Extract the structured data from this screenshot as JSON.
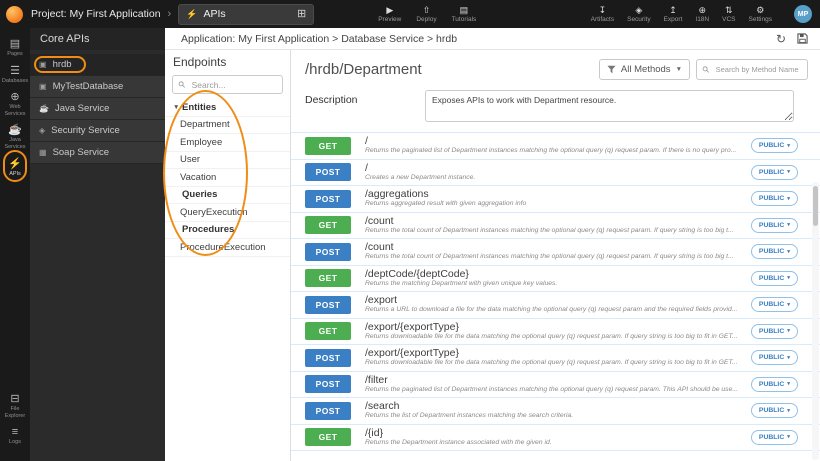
{
  "topbar": {
    "project": "Project: My First Application",
    "chevron": "›",
    "tab": {
      "label": "APIs",
      "icon_glyph": "⚡",
      "grid_glyph": "⊞"
    },
    "center_actions": [
      {
        "name": "preview",
        "label": "Preview",
        "glyph": "▶"
      },
      {
        "name": "deploy",
        "label": "Deploy",
        "glyph": "⇧"
      },
      {
        "name": "tutorials",
        "label": "Tutorials",
        "glyph": "▤"
      }
    ],
    "right_actions": [
      {
        "name": "artifacts",
        "label": "Artifacts",
        "glyph": "↧"
      },
      {
        "name": "security",
        "label": "Security",
        "glyph": "◈"
      },
      {
        "name": "export",
        "label": "Export",
        "glyph": "↥"
      },
      {
        "name": "i18n",
        "label": "I18N",
        "glyph": "⊕"
      },
      {
        "name": "vcs",
        "label": "VCS",
        "glyph": "⇅"
      },
      {
        "name": "settings",
        "label": "Settings",
        "glyph": "⚙"
      }
    ],
    "avatar_initials": "MP"
  },
  "rail": {
    "top_items": [
      {
        "name": "pages",
        "label": "Pages",
        "glyph": "▤"
      },
      {
        "name": "databases",
        "label": "Databases",
        "glyph": "☰"
      },
      {
        "name": "web-services",
        "label": "Web Services",
        "glyph": "⊕"
      },
      {
        "name": "java-services",
        "label": "Java Services",
        "glyph": "☕"
      },
      {
        "name": "apis",
        "label": "APIs",
        "glyph": "⚡",
        "cls": "active"
      }
    ],
    "bottom_items": [
      {
        "name": "file-explorer",
        "label": "File Explorer",
        "glyph": "⊟"
      },
      {
        "name": "logs",
        "label": "Logs",
        "glyph": "≡"
      }
    ]
  },
  "sidebar": {
    "title": "Core APIs",
    "items": [
      {
        "name": "hrdb",
        "label": "hrdb",
        "glyph": "▣",
        "cls": "selected"
      },
      {
        "name": "mytestdatabase",
        "label": "MyTestDatabase",
        "glyph": "▣"
      },
      {
        "name": "java-service",
        "label": "Java Service",
        "glyph": "☕"
      },
      {
        "name": "security-service",
        "label": "Security Service",
        "glyph": "◈"
      },
      {
        "name": "soap-service",
        "label": "Soap Service",
        "glyph": "▦"
      }
    ]
  },
  "breadcrumb": {
    "text": "Application: My First Application > Database Service > hrdb",
    "refresh_glyph": "↻"
  },
  "endpoints": {
    "title": "Endpoints",
    "search_placeholder": "Search...",
    "tree": [
      {
        "label": "Entities",
        "cls": "group",
        "caret": "▼"
      },
      {
        "label": "Department",
        "cls": "leaf"
      },
      {
        "label": "Employee",
        "cls": "leaf"
      },
      {
        "label": "User",
        "cls": "leaf"
      },
      {
        "label": "Vacation",
        "cls": "leaf"
      },
      {
        "label": "Queries",
        "cls": "group"
      },
      {
        "label": "QueryExecution",
        "cls": "leaf"
      },
      {
        "label": "Procedures",
        "cls": "group"
      },
      {
        "label": "ProcedureExecution",
        "cls": "leaf"
      }
    ]
  },
  "main": {
    "title": "/hrdb/Department",
    "filter_label": "All Methods",
    "filter_caret": "▼",
    "search_placeholder": "Search by Method Name or URL...",
    "description_label": "Description",
    "description_value": "Exposes APIs to work with Department resource.",
    "access_caret": "▾",
    "rows": [
      {
        "method": "GET",
        "path": "/",
        "desc": "Returns the paginated list of Department instances matching the optional query (q) request param. If there is no query pro...",
        "access": "PUBLIC"
      },
      {
        "method": "POST",
        "path": "/",
        "desc": "Creates a new Department instance.",
        "access": "PUBLIC"
      },
      {
        "method": "POST",
        "path": "/aggregations",
        "desc": "Returns aggregated result with given aggregation info",
        "access": "PUBLIC"
      },
      {
        "method": "GET",
        "path": "/count",
        "desc": "Returns the total count of Department instances matching the optional query (q) request param. If query string is too big t...",
        "access": "PUBLIC"
      },
      {
        "method": "POST",
        "path": "/count",
        "desc": "Returns the total count of Department instances matching the optional query (q) request param. If query string is too big t...",
        "access": "PUBLIC"
      },
      {
        "method": "GET",
        "path": "/deptCode/{deptCode}",
        "desc": "Returns the matching Department with given unique key values.",
        "access": "PUBLIC"
      },
      {
        "method": "POST",
        "path": "/export",
        "desc": "Returns a URL to download a file for the data matching the optional query (q) request param and the required fields provid...",
        "access": "PUBLIC"
      },
      {
        "method": "GET",
        "path": "/export/{exportType}",
        "desc": "Returns downloadable file for the data matching the optional query (q) request param. If query string is too big to fit in GET...",
        "access": "PUBLIC"
      },
      {
        "method": "POST",
        "path": "/export/{exportType}",
        "desc": "Returns downloadable file for the data matching the optional query (q) request param. If query string is too big to fit in GET...",
        "access": "PUBLIC"
      },
      {
        "method": "POST",
        "path": "/filter",
        "desc": "Returns the paginated list of Department instances matching the optional query (q) request param. This API should be use...",
        "access": "PUBLIC"
      },
      {
        "method": "POST",
        "path": "/search",
        "desc": "Returns the list of Department instances matching the search criteria.",
        "access": "PUBLIC"
      },
      {
        "method": "GET",
        "path": "/{id}",
        "desc": "Returns the Department instance associated with the given id.",
        "access": "PUBLIC"
      }
    ]
  },
  "colors": {
    "get_badge": "#4cae50",
    "post_badge": "#3b7fc4",
    "annotation_orange": "#ef8d15",
    "accent_blue": "#3a80c0"
  }
}
